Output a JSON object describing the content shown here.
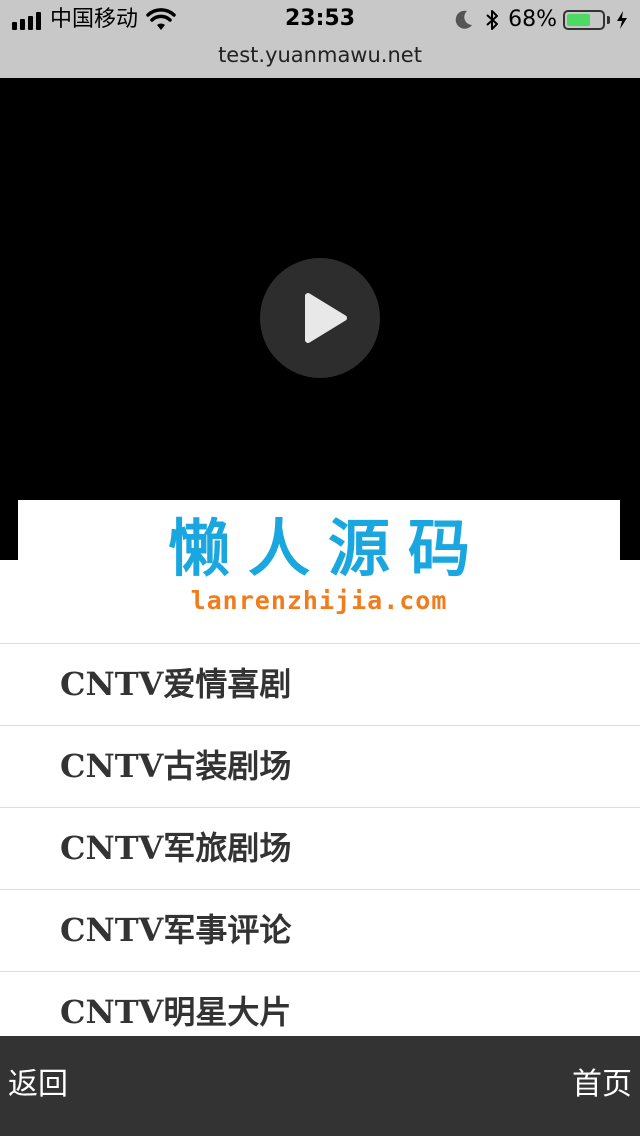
{
  "status_bar": {
    "carrier": "中国移动",
    "time": "23:53",
    "battery_percent": "68%",
    "battery_level": 0.68,
    "icons": [
      "signal-icon",
      "wifi-icon",
      "moon-icon",
      "bluetooth-icon",
      "battery-icon",
      "charging-icon"
    ]
  },
  "browser": {
    "url": "test.yuanmawu.net"
  },
  "video": {
    "play_icon": "play-icon"
  },
  "logo": {
    "title_cn": "懒人源码",
    "subtitle_en": "lanrenzhijia.com"
  },
  "channels": [
    {
      "label": "CNTV爱情喜剧"
    },
    {
      "label": "CNTV古装剧场"
    },
    {
      "label": "CNTV军旅剧场"
    },
    {
      "label": "CNTV军事评论"
    },
    {
      "label": "CNTV明星大片"
    }
  ],
  "bottom_bar": {
    "back_label": "返回",
    "home_label": "首页"
  },
  "colors": {
    "logo_blue": "#1aa7e0",
    "logo_orange": "#f07c1c",
    "bottom_bar_bg": "#333333",
    "battery_green": "#4cd964"
  }
}
